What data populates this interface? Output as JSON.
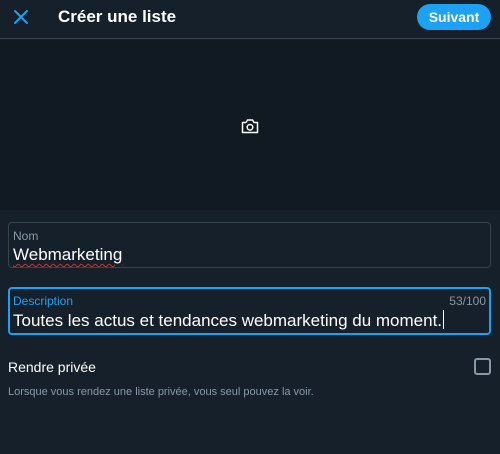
{
  "header": {
    "close_icon": "close-icon",
    "title": "Créer une liste",
    "next_label": "Suivant"
  },
  "banner": {
    "camera_icon": "camera-icon"
  },
  "form": {
    "name": {
      "label": "Nom",
      "value": "Webmarketing"
    },
    "description": {
      "label": "Description",
      "value": "Toutes les actus et tendances webmarketing du moment.",
      "counter": "53/100"
    },
    "private": {
      "label": "Rendre privée",
      "checked": false,
      "help": "Lorsque vous rendez une liste privée, vous seul pouvez la voir."
    }
  },
  "colors": {
    "background": "#15202b",
    "accent": "#1da1f2",
    "muted": "#8899a6",
    "border": "#38444d"
  }
}
